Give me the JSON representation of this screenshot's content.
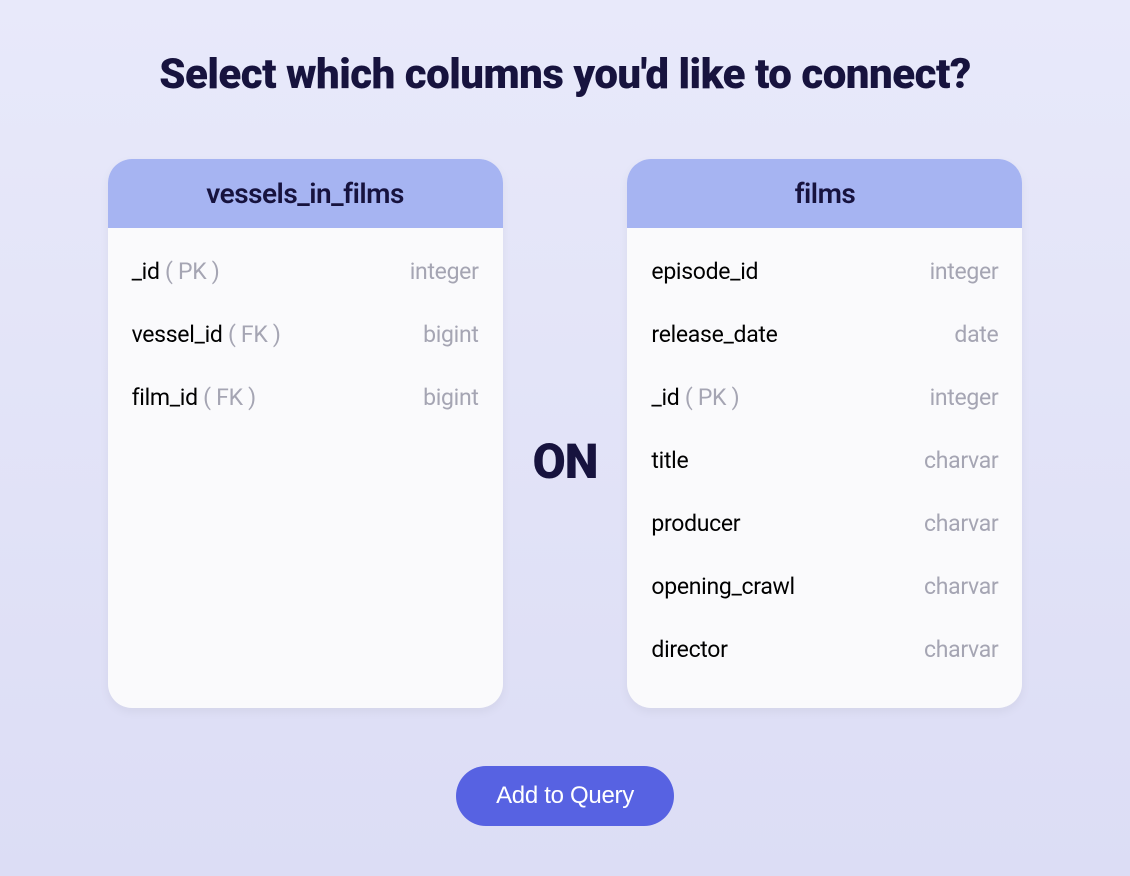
{
  "title": "Select which columns you'd like to connect?",
  "joinKeyword": "ON",
  "leftTable": {
    "name": "vessels_in_films",
    "columns": [
      {
        "name": "_id",
        "key": "( PK )",
        "type": "integer"
      },
      {
        "name": "vessel_id",
        "key": "( FK )",
        "type": "bigint"
      },
      {
        "name": "film_id",
        "key": "( FK )",
        "type": "bigint"
      }
    ]
  },
  "rightTable": {
    "name": "films",
    "columns": [
      {
        "name": "episode_id",
        "key": "",
        "type": "integer"
      },
      {
        "name": "release_date",
        "key": "",
        "type": "date"
      },
      {
        "name": "_id",
        "key": "( PK )",
        "type": "integer"
      },
      {
        "name": "title",
        "key": "",
        "type": "charvar"
      },
      {
        "name": "producer",
        "key": "",
        "type": "charvar"
      },
      {
        "name": "opening_crawl",
        "key": "",
        "type": "charvar"
      },
      {
        "name": "director",
        "key": "",
        "type": "charvar"
      }
    ]
  },
  "addButtonLabel": "Add to Query"
}
